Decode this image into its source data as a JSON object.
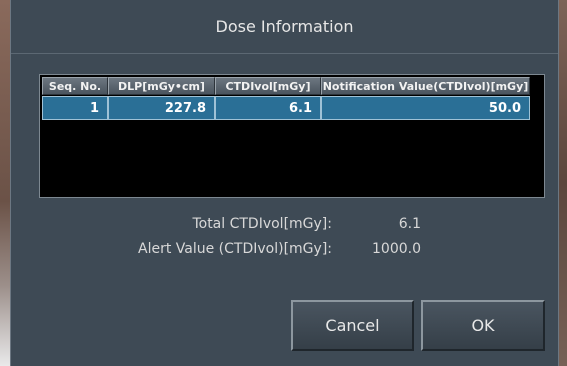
{
  "dialog": {
    "title": "Dose Information"
  },
  "table": {
    "columns": [
      "Seq. No.",
      "DLP[mGy•cm]",
      "CTDIvol[mGy]",
      "Notification Value(CTDIvol)[mGy]"
    ],
    "rows": [
      [
        "1",
        "227.8",
        "6.1",
        "50.0"
      ]
    ]
  },
  "summary": {
    "total_label": "Total CTDIvol[mGy]:",
    "total_value": "6.1",
    "alert_label": "Alert Value (CTDIvol)[mGy]:",
    "alert_value": "1000.0"
  },
  "buttons": {
    "cancel": "Cancel",
    "ok": "OK"
  },
  "colors": {
    "dialog_bg": "#3e4a55",
    "selected_row": "#2a6f96",
    "table_bg": "#000000"
  }
}
